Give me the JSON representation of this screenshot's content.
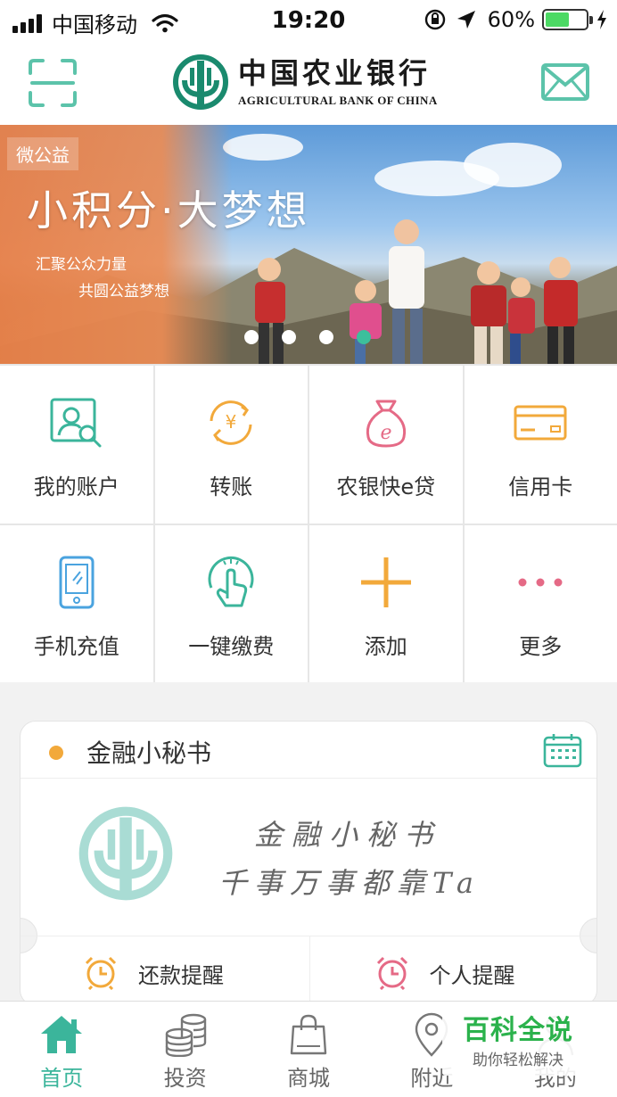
{
  "status_bar": {
    "carrier": "中国移动",
    "time": "19:20",
    "battery": "60%",
    "battery_level": 0.6,
    "icons": [
      "signal-icon",
      "wifi-icon",
      "lock-rotation-icon",
      "location-icon",
      "battery-icon",
      "charging-icon"
    ]
  },
  "header": {
    "bank_name_cn": "中国农业银行",
    "bank_name_en": "AGRICULTURAL BANK OF CHINA",
    "icons": {
      "left": "scan-icon",
      "right": "mail-icon"
    }
  },
  "banner": {
    "tag": "微公益",
    "title": "小积分·大梦想",
    "subtitle_1": "汇聚公众力量",
    "subtitle_2": "共圆公益梦想",
    "slide_count": 4,
    "active_slide": 4
  },
  "menu": {
    "items": [
      {
        "label": "我的账户",
        "icon": "account-search-icon"
      },
      {
        "label": "转账",
        "icon": "yuan-transfer-icon"
      },
      {
        "label": "农银快e贷",
        "icon": "money-bag-e-icon"
      },
      {
        "label": "信用卡",
        "icon": "credit-card-icon"
      },
      {
        "label": "手机充值",
        "icon": "phone-recharge-icon"
      },
      {
        "label": "一键缴费",
        "icon": "tap-pay-icon"
      },
      {
        "label": "添加",
        "icon": "plus-icon"
      },
      {
        "label": "更多",
        "icon": "more-dots-icon"
      }
    ]
  },
  "secretary": {
    "title": "金融小秘书",
    "handwriting_line_1": "金融小秘书",
    "handwriting_line_2": "千事万事都靠Ta",
    "actions": [
      {
        "label": "还款提醒",
        "icon": "alarm-clock-icon"
      },
      {
        "label": "个人提醒",
        "icon": "alarm-clock-icon"
      }
    ]
  },
  "tabbar": {
    "tabs": [
      {
        "label": "首页",
        "icon": "home-icon",
        "active": true
      },
      {
        "label": "投资",
        "icon": "coins-icon",
        "active": false
      },
      {
        "label": "商城",
        "icon": "shopping-bag-icon",
        "active": false
      },
      {
        "label": "附近",
        "icon": "location-pin-icon",
        "active": false
      },
      {
        "label": "我的",
        "icon": "user-icon",
        "active": false
      }
    ]
  },
  "watermark": {
    "title": "百科全说",
    "subtitle": "助你轻松解决"
  },
  "colors": {
    "brand_green": "#3bb59b",
    "accent_orange": "#f2a93b",
    "accent_pink": "#e56a86",
    "accent_blue": "#4aa3df"
  }
}
